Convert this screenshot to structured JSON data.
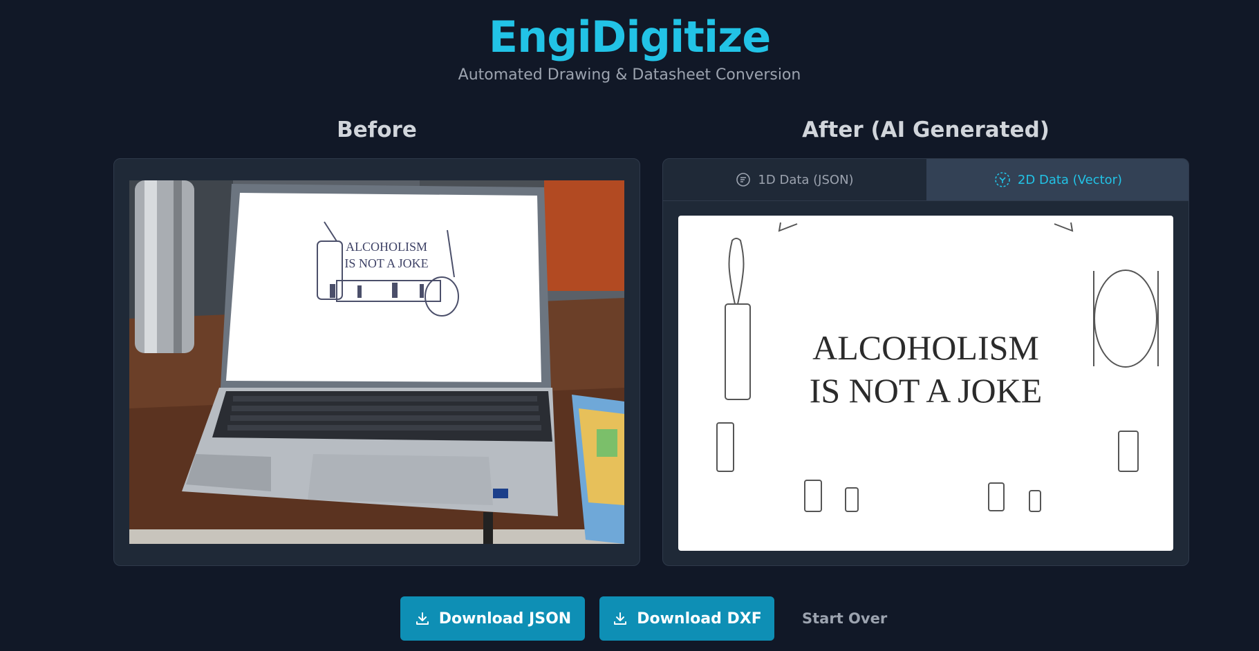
{
  "header": {
    "title": "EngiDigitize",
    "subtitle": "Automated Drawing & Datasheet Conversion"
  },
  "before": {
    "title": "Before",
    "photo_text_line1": "ALCOHOLISM",
    "photo_text_line2": "IS NOT A JOKE"
  },
  "after": {
    "title": "After (AI Generated)",
    "tabs": [
      {
        "label": "1D Data (JSON)",
        "icon": "list-icon",
        "active": false
      },
      {
        "label": "2D Data (Vector)",
        "icon": "vector-icon",
        "active": true
      }
    ],
    "vector_text_line1": "ALCOHOLISM",
    "vector_text_line2": "IS NOT A JOKE"
  },
  "actions": {
    "download_json": "Download JSON",
    "download_dxf": "Download DXF",
    "start_over": "Start Over"
  },
  "colors": {
    "background": "#111827",
    "panel": "#1f2937",
    "accent": "#22c3e6",
    "button": "#0e8fb5",
    "active_tab": "#334155"
  }
}
